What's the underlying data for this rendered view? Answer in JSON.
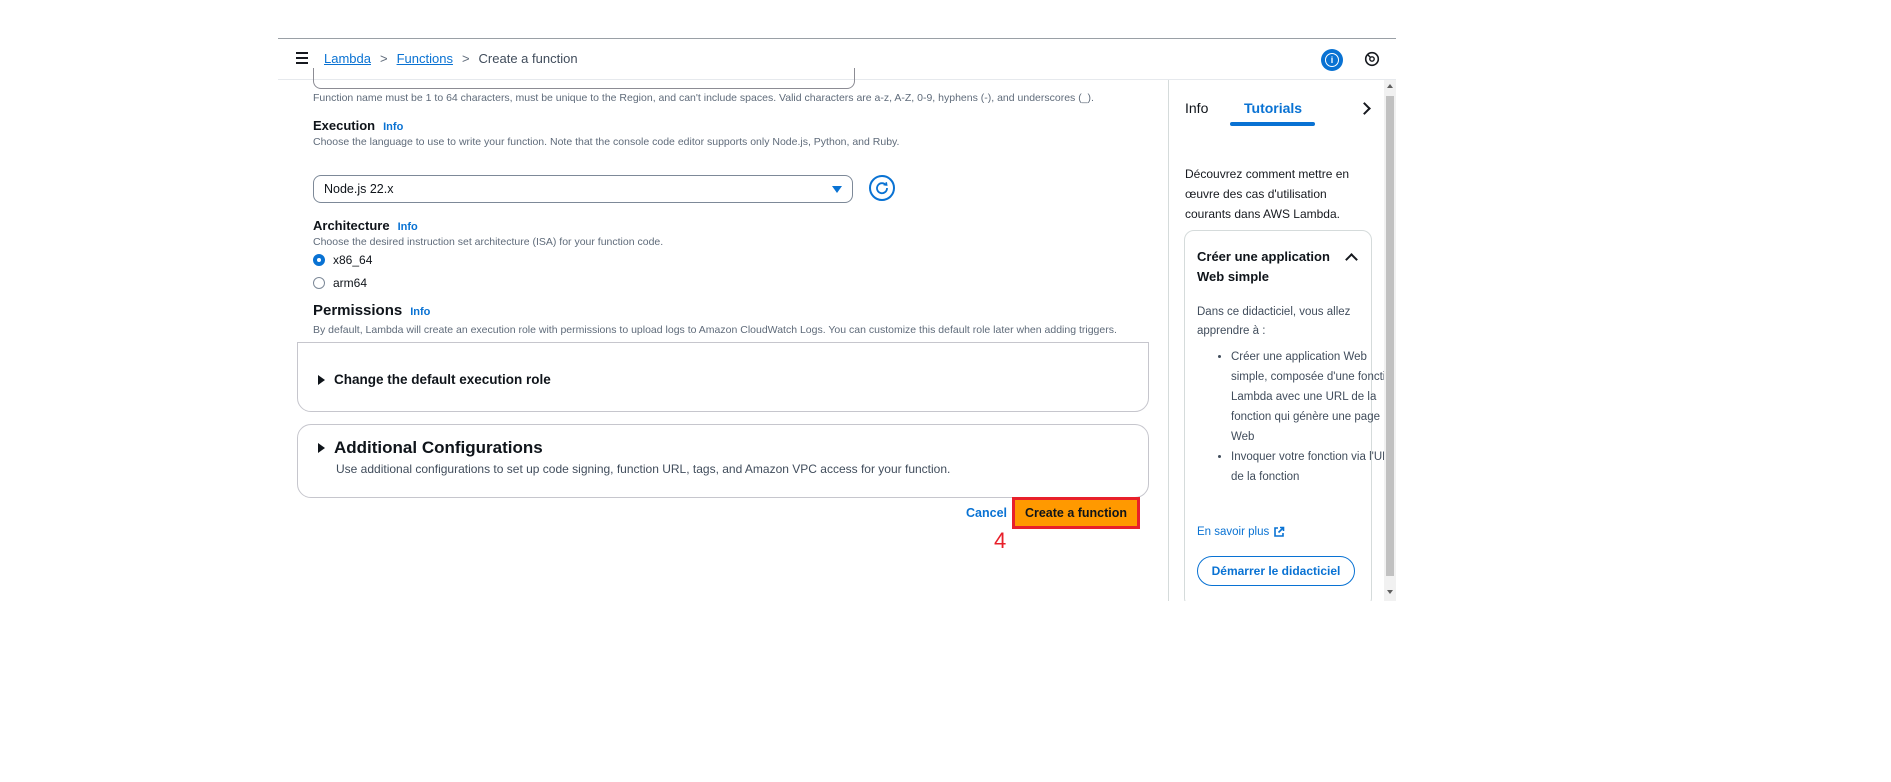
{
  "breadcrumb": {
    "items": [
      "Lambda",
      "Functions"
    ],
    "current": "Create a function"
  },
  "form": {
    "name_hint": "Function name must be 1 to 64 characters, must be unique to the Region, and can't include spaces. Valid characters are a-z, A-Z, 0-9, hyphens (-), and underscores (_).",
    "execution": {
      "label": "Execution",
      "info": "Info",
      "hint": "Choose the language to use to write your function. Note that the console code editor supports only Node.js, Python, and Ruby.",
      "selected": "Node.js 22.x"
    },
    "architecture": {
      "label": "Architecture",
      "info": "Info",
      "hint": "Choose the desired instruction set architecture (ISA) for your function code.",
      "options": [
        "x86_64",
        "arm64"
      ],
      "selected": "x86_64"
    },
    "permissions": {
      "label": "Permissions",
      "info": "Info",
      "hint": "By default, Lambda will create an execution role with permissions to upload logs to Amazon CloudWatch Logs. You can customize this default role later when adding triggers.",
      "expand_label": "Change the default execution role"
    },
    "additional": {
      "title": "Additional Configurations",
      "desc": "Use additional configurations to set up code signing, function URL, tags, and Amazon VPC access for your function."
    }
  },
  "actions": {
    "cancel": "Cancel",
    "create": "Create a function",
    "step_marker": "4"
  },
  "panel": {
    "tabs": [
      "Info",
      "Tutorials"
    ],
    "active_tab": "Tutorials",
    "intro": "Découvrez comment mettre en œuvre des cas d'utilisation courants dans AWS Lambda.",
    "tutorial": {
      "title": "Créer une application Web simple",
      "desc": "Dans ce didacticiel, vous allez apprendre à :",
      "bullets": [
        "Créer une application Web simple, composée d'une fonction Lambda avec une URL de la fonction qui génère une page Web",
        "Invoquer votre fonction via l'URL de la fonction"
      ],
      "learn_more": "En savoir plus",
      "start_button": "Démarrer le didacticiel"
    }
  },
  "colors": {
    "accent": "#0972d3",
    "primary_button": "#ff9900",
    "highlight": "#e8202a"
  }
}
